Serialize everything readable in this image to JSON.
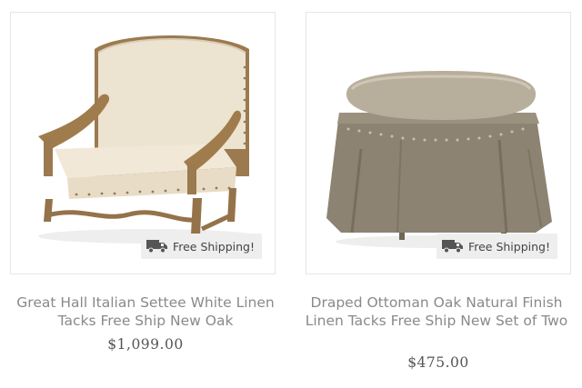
{
  "products": [
    {
      "title": "Great Hall Italian Settee White Linen Tacks Free Ship New Oak",
      "price": "$1,099.00",
      "badge": "Free Shipping!",
      "image_icon": "settee-image"
    },
    {
      "title": "Draped Ottoman Oak Natural Finish Linen Tacks Free Ship New Set of Two",
      "price": "$475.00",
      "badge": "Free Shipping!",
      "image_icon": "ottoman-image"
    }
  ],
  "colors": {
    "title_text": "#8a8a8a",
    "price_text": "#555555",
    "badge_bg": "#eeeeee",
    "card_border": "#e6e6e6"
  }
}
